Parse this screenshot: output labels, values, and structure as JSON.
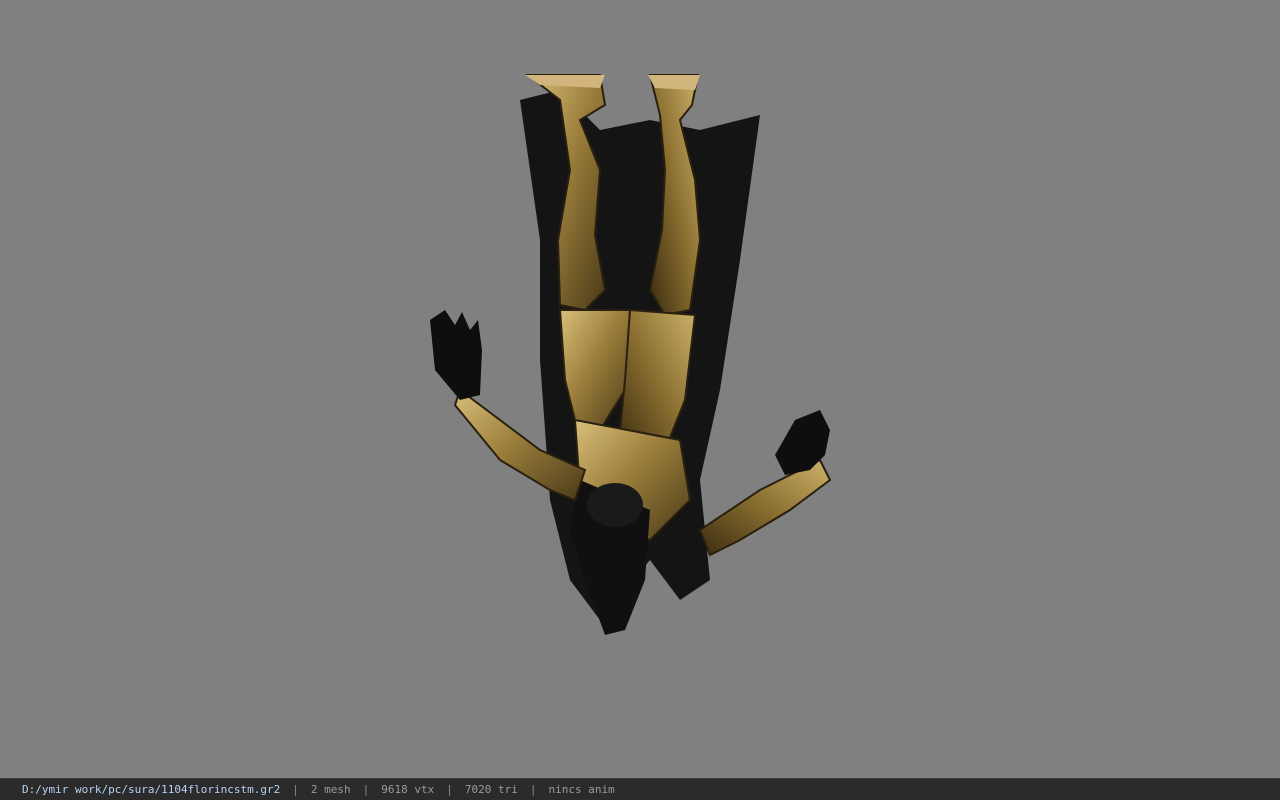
{
  "viewport": {
    "background_color": "#808080",
    "model_description_icon": "armored-figure-icon"
  },
  "statusbar": {
    "file_path": "D:/ymir work/pc/sura/1104florincstm.gr2",
    "mesh_count": "2 mesh",
    "vertex_count": "9618 vtx",
    "triangle_count": "7020 tri",
    "animation": "nincs anim",
    "separator": "|"
  }
}
